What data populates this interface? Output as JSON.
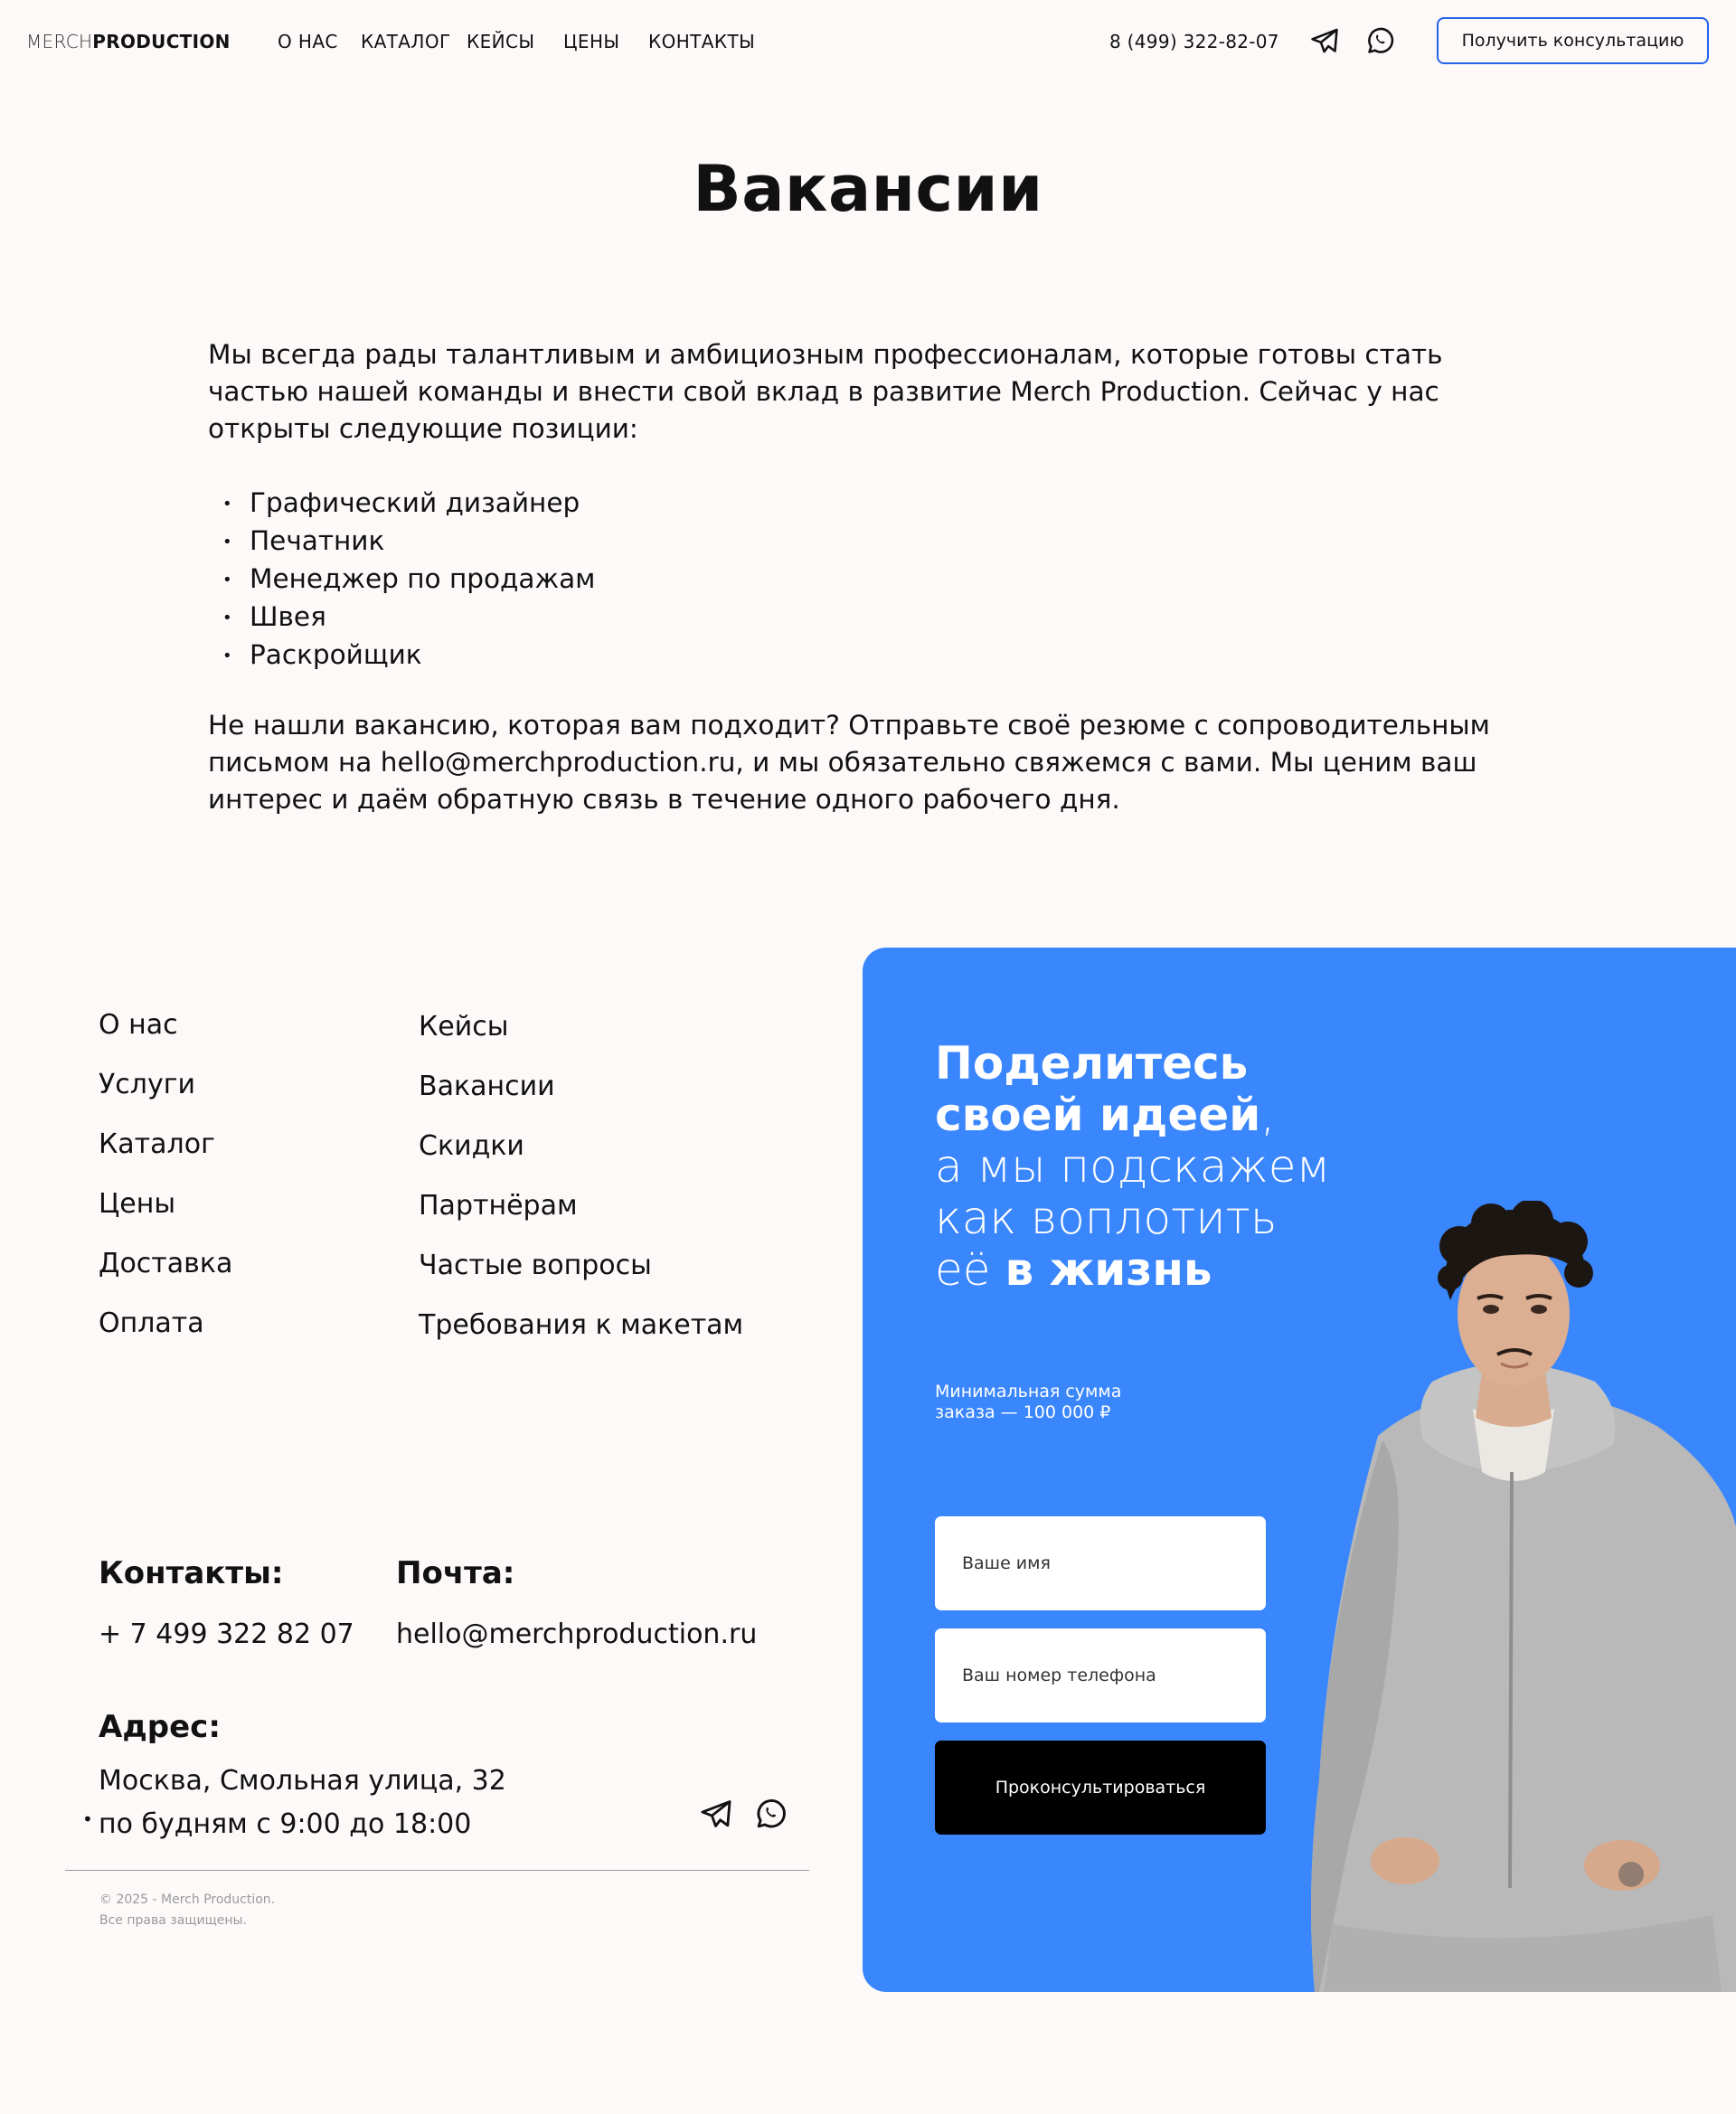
{
  "header": {
    "logo_light": "MERCH",
    "logo_bold": "PRODUCTION",
    "nav": [
      "О НАС",
      "КАТАЛОГ",
      "КЕЙСЫ",
      "ЦЕНЫ",
      "КОНТАКТЫ"
    ],
    "phone": "8 (499) 322-82-07",
    "icons": [
      "telegram-icon",
      "whatsapp-icon"
    ],
    "cta_label": "Получить консультацию",
    "cta_border_color": "#2563eb"
  },
  "main": {
    "title": "Вакансии",
    "intro": "Мы всегда рады талантливым и амбициозным профессионалам, которые готовы стать частью нашей команды и внести свой вклад в развитие Merch Production. Сейчас у нас открыты следующие позиции:",
    "vacancies": [
      "Графический дизайнер",
      "Печатник",
      "Менеджер по продажам",
      "Швея",
      "Раскройщик"
    ],
    "outro": "Не нашли вакансию, которая вам подходит? Отправьте своё резюме с сопроводительным письмом на hello@merchproduction.ru, и мы обязательно свяжемся с вами. Мы ценим ваш интерес и даём обратную связь в течение одного рабочего дня."
  },
  "footer": {
    "col1": [
      "О нас",
      "Услуги",
      "Каталог",
      "Цены",
      "Доставка",
      "Оплата"
    ],
    "col2": [
      "Кейсы",
      "Вакансии",
      "Скидки",
      "Партнёрам",
      "Частые вопросы",
      "Требования к макетам"
    ],
    "contacts_label": "Контакты:",
    "contacts_phone": "+ 7 499 322 82 07",
    "mail_label": "Почта:",
    "mail_value": "hello@merchproduction.ru",
    "address_label": "Адрес:",
    "address_line": "Москва, Смольная улица, 32",
    "hours_line": "по будням с 9:00 до 18:00",
    "copyright_1": "© 2025 - Merch Production.",
    "copyright_2": "Все права защищены."
  },
  "cta_panel": {
    "headline_bold_1": "Поделитесь",
    "headline_bold_2": "своей идеей",
    "headline_comma": ",",
    "headline_light_1": "а мы подскажем",
    "headline_light_2": "как воплотить",
    "headline_light_3": "её",
    "headline_bold_3": "в жизнь",
    "min_sum": "Минимальная сумма заказа — 100 000 ₽",
    "name_placeholder": "Ваше имя",
    "phone_placeholder": "Ваш номер телефона",
    "submit_label": "Проконсультироваться",
    "panel_color": "#3a86fd"
  }
}
